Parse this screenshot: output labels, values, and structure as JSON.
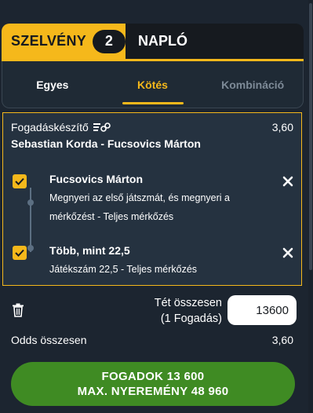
{
  "tabs": {
    "slip_label": "SZELVÉNY",
    "slip_count": "2",
    "log_label": "NAPLÓ"
  },
  "sub_tabs": [
    {
      "label": "Egyes"
    },
    {
      "label": "Kötés"
    },
    {
      "label": "Kombináció"
    }
  ],
  "bet": {
    "builder_label": "Fogadáskészítő",
    "builder_odds": "3,60",
    "match": "Sebastian Korda - Fucsovics Márton",
    "selections": [
      {
        "title": "Fucsovics Márton",
        "desc_line1": "Megnyeri az első játszmát, és megnyeri a",
        "desc_line2": "mérkőzést - Teljes mérkőzés"
      },
      {
        "title": "Több, mint 22,5",
        "desc_line1": "Játékszám 22,5 - Teljes mérkőzés"
      }
    ]
  },
  "stake": {
    "label_line1": "Tét összesen",
    "label_line2": "(1 Fogadás)",
    "value": "13600"
  },
  "odds_total": {
    "label": "Odds összesen",
    "value": "3,60"
  },
  "place_button": {
    "line1": "FOGADOK 13 600",
    "line2": "MAX. NYEREMÉNY 48 960"
  },
  "colors": {
    "accent": "#f5b81b",
    "background": "#1c2530",
    "card": "#253240",
    "cta": "#3f8b23"
  },
  "icons": [
    "bet-builder-icon",
    "checkbox-checked-icon",
    "close-icon",
    "trash-icon"
  ]
}
